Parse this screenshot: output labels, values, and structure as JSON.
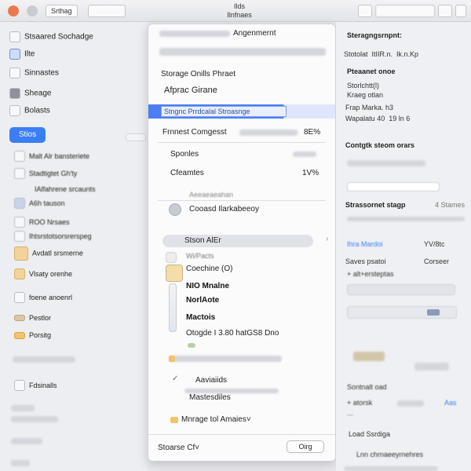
{
  "toolbar": {
    "left_button": "Srthag",
    "title_line1": "Ilds",
    "title_line2": "Ilnfnaes"
  },
  "sidebar": {
    "items": [
      {
        "label": "Stsaared Sochadge"
      },
      {
        "label": "Ilte"
      },
      {
        "label": "Sinnastes"
      },
      {
        "label": "Sheage"
      },
      {
        "label": "Bolasts"
      },
      {
        "label": "Stios"
      },
      {
        "label": "Malt Alr bansteriete"
      },
      {
        "label": "Stadtigtet Gh'ty"
      },
      {
        "label": "IAlfahrene srcaunts"
      },
      {
        "label": "A6h tauson"
      },
      {
        "label": "ROO Nrsaes"
      },
      {
        "label": "Ihtsrstotsorsrerspeg"
      },
      {
        "label": "Avdatl srsmerne"
      },
      {
        "label": "Vlsaty orenhe"
      },
      {
        "label": "foene anoenrl"
      },
      {
        "label": "Pestlor"
      },
      {
        "label": "Porsitg"
      },
      {
        "label": "Fdsinalls"
      }
    ]
  },
  "panel": {
    "header": "Angenmernt",
    "sub1": "Storage Onills Phraet",
    "sub2": "Afprac Girane",
    "highlight": "Stngnc Prrdcalal Stroasnge",
    "row1_label": "Frnnest Comgesst",
    "row1_value": "8E%",
    "row2_label": "Sponles",
    "row2_value": "",
    "row3_label": "Cfeamtes",
    "row3_value": "1V%",
    "section_title": "Aeeaeaeahan",
    "account": "Cooasd Ilarkabeeoy",
    "pill_label": "Stson AlEr",
    "list": [
      "Wi/Pacts",
      "Coechine (O)",
      "NIO Mnalne",
      "NorlAote",
      "Mactois",
      "Otogde I 3.80 hatGS8 Dno"
    ],
    "minor1": "Aaviaiids",
    "minor2": "Mastesdiles",
    "bottom_item": "Mnrage tol Amaies˅",
    "footer_label": "Stoarse Cf˅",
    "ok_label": "Oirg"
  },
  "right": {
    "title": "Steragngsrnpnt:",
    "line1": "Stotolat  ItIIR.n.  Ik.n.Kp",
    "section1": "Pteaanet onoe",
    "s1a": "Storlchtt(l)",
    "s1b": "Kraeg otlan",
    "s1c": "Frap Marka. h3",
    "s1d": "Wapalatu 40  19 ln 6",
    "section2": "Contgtk steom orars",
    "section3": "Strassornet stagp",
    "section3_tail": "4 Stames",
    "link1": "Ihra Mardoi",
    "val1": "YV/8tc",
    "s3a": "Saves psatoi",
    "s3b": "Corseer",
    "s3c": "+ alt+ersteptas",
    "s4a": "Sontnalt oad",
    "s4b": "+ atorsk",
    "s4c": "Aas",
    "s4d": "Load Ssrdiga",
    "s4e": "Lnn chrnaeeyrnehres",
    "accent": "#3b7df5"
  }
}
